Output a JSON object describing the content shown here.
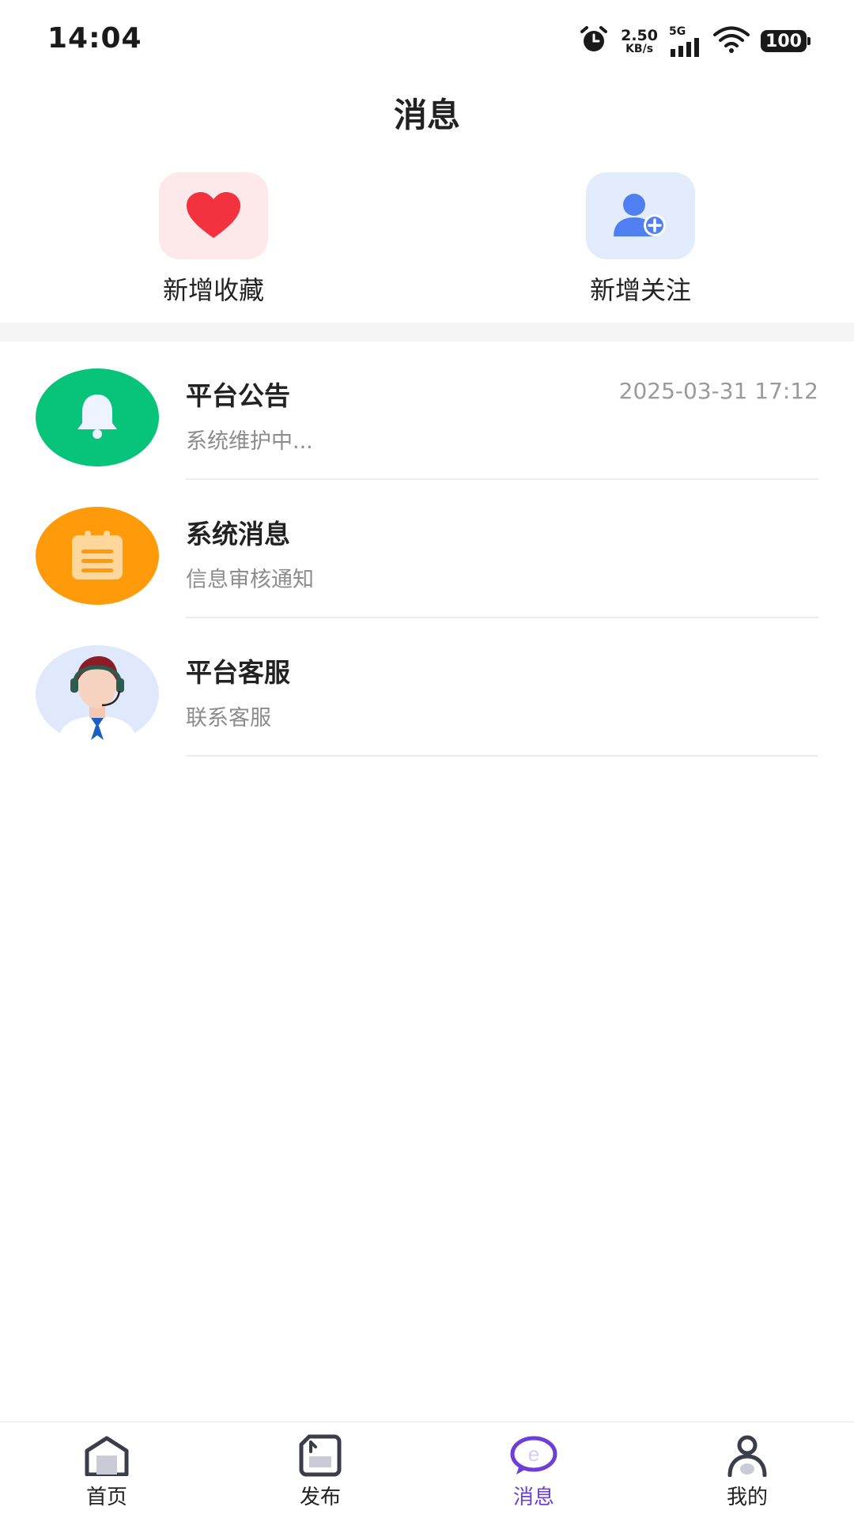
{
  "status_bar": {
    "time": "14:04",
    "net_speed_value": "2.50",
    "net_speed_unit": "KB/s",
    "network": "5G",
    "battery": "100"
  },
  "header": {
    "title": "消息"
  },
  "quick_actions": [
    {
      "label": "新增收藏",
      "icon": "heart-icon",
      "color": "#f2323f"
    },
    {
      "label": "新增关注",
      "icon": "add-user-icon",
      "color": "#4f7ff0"
    }
  ],
  "messages": [
    {
      "title": "平台公告",
      "subtitle": "系统维护中...",
      "time": "2025-03-31 17:12",
      "icon": "bell-icon",
      "color": "#08c47a"
    },
    {
      "title": "系统消息",
      "subtitle": "信息审核通知",
      "time": "",
      "icon": "clipboard-icon",
      "color": "#ff9a0a"
    },
    {
      "title": "平台客服",
      "subtitle": "联系客服",
      "time": "",
      "icon": "customer-service-avatar",
      "color": "#dfe9fb"
    }
  ],
  "bottom_nav": [
    {
      "label": "首页",
      "icon": "home-icon",
      "active": false
    },
    {
      "label": "发布",
      "icon": "publish-icon",
      "active": false
    },
    {
      "label": "消息",
      "icon": "message-icon",
      "active": true
    },
    {
      "label": "我的",
      "icon": "profile-icon",
      "active": false
    }
  ],
  "colors": {
    "accent": "#6d3fd6"
  }
}
